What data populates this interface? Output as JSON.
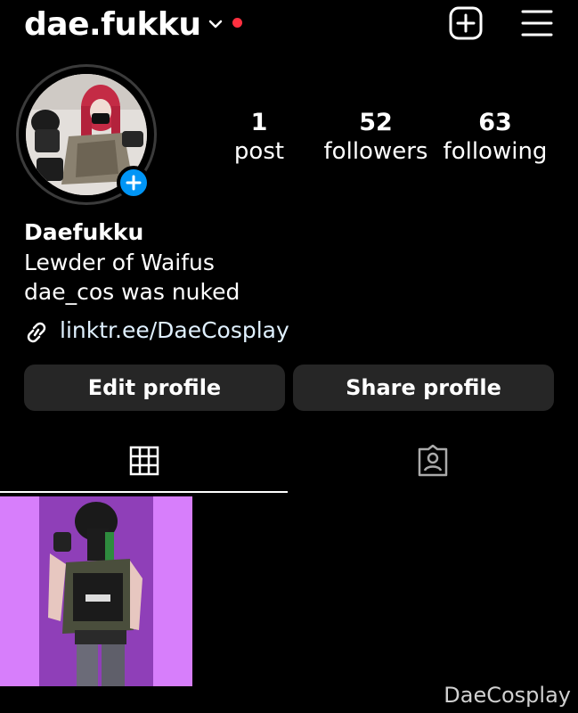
{
  "header": {
    "username": "dae.fukku",
    "icons": [
      "chevron-down-icon",
      "notification-dot",
      "create-plus-icon",
      "menu-icon"
    ]
  },
  "profile": {
    "stats": [
      {
        "value": "1",
        "label": "post"
      },
      {
        "value": "52",
        "label": "followers"
      },
      {
        "value": "63",
        "label": "following"
      }
    ],
    "display_name": "Daefukku",
    "bio_lines": [
      "Lewder of Waifus",
      "dae_cos was nuked"
    ],
    "link": "linktr.ee/DaeCosplay"
  },
  "buttons": {
    "edit_label": "Edit profile",
    "share_label": "Share profile"
  },
  "tabs": [
    {
      "icon": "grid-icon",
      "active": true
    },
    {
      "icon": "tagged-icon",
      "active": false
    }
  ],
  "watermark": "DaeCosplay",
  "colors": {
    "accent": "#0095f6",
    "notification": "#ff3040",
    "button_bg": "#262626"
  }
}
